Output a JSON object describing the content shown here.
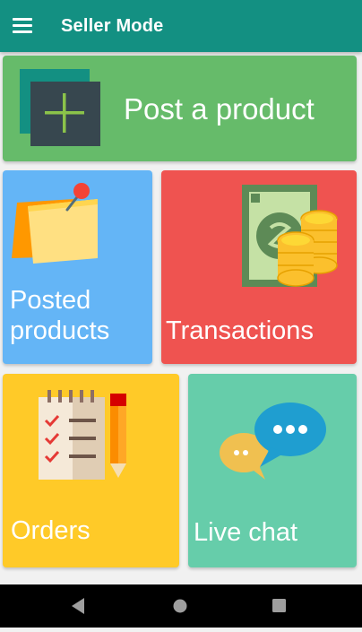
{
  "appbar": {
    "title": "Seller Mode",
    "menu_icon": "hamburger-menu-icon",
    "background": "#139082"
  },
  "tiles": [
    {
      "id": "post",
      "label": "Post a product",
      "icon": "add-product-icon",
      "color": "#66bb6a"
    },
    {
      "id": "posted",
      "label_line1": "Posted",
      "label_line2": "products",
      "icon": "sticky-note-icon",
      "color": "#64b5f6"
    },
    {
      "id": "transactions",
      "label": "Transactions",
      "icon": "money-coins-icon",
      "color": "#ef5350"
    },
    {
      "id": "orders",
      "label": "Orders",
      "icon": "checklist-icon",
      "color": "#ffca28"
    },
    {
      "id": "chat",
      "label": "Live chat",
      "icon": "chat-bubbles-icon",
      "color": "#66cdaa"
    }
  ],
  "navbar": {
    "back_icon": "back-triangle-icon",
    "home_icon": "home-circle-icon",
    "recents_icon": "recents-square-icon"
  }
}
